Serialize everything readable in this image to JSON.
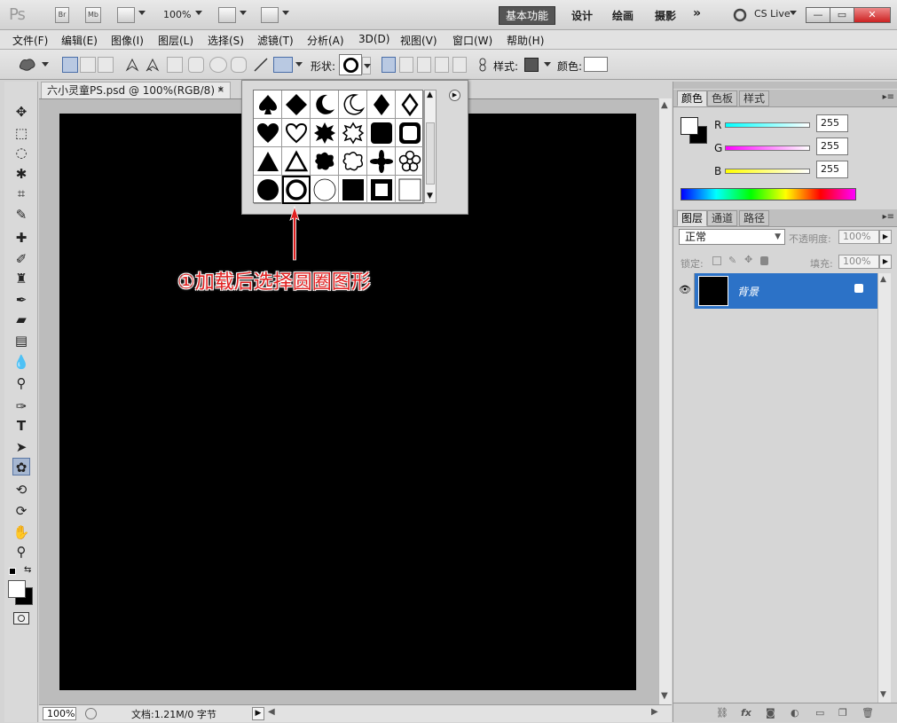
{
  "appbar": {
    "logo": "Ps",
    "bridge": "Br",
    "minibridge": "Mb",
    "zoom": "100%",
    "workspaces": [
      "基本功能",
      "设计",
      "绘画",
      "摄影"
    ],
    "more": "»",
    "cslive": "CS Live",
    "window_controls": [
      "—",
      "▭",
      "✕"
    ]
  },
  "menu": [
    "文件(F)",
    "编辑(E)",
    "图像(I)",
    "图层(L)",
    "选择(S)",
    "滤镜(T)",
    "分析(A)",
    "3D(D)",
    "视图(V)",
    "窗口(W)",
    "帮助(H)"
  ],
  "options": {
    "shape_label": "形状:",
    "style_label": "样式:",
    "color_label": "颜色:"
  },
  "document": {
    "tab_title": "六小灵童PS.psd @ 100%(RGB/8) *",
    "close": "×",
    "zoom": "100%",
    "status": "文档:1.21M/0 字节"
  },
  "annotation": "①加载后选择圆圈图形",
  "color_panel": {
    "tabs": [
      "颜色",
      "色板",
      "样式"
    ],
    "r_label": "R",
    "g_label": "G",
    "b_label": "B",
    "r": "255",
    "g": "255",
    "b": "255"
  },
  "layers_panel": {
    "tabs": [
      "图层",
      "通道",
      "路径"
    ],
    "blend_mode": "正常",
    "opacity_label": "不透明度:",
    "opacity": "100%",
    "lock_label": "锁定:",
    "fill_label": "填充:",
    "fill": "100%",
    "layer_name": "背景"
  },
  "colors": {
    "canvas": "#000000",
    "accent_selection": "#2c72c7",
    "annotation": "#e02020"
  }
}
